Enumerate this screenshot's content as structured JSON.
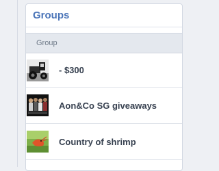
{
  "panel": {
    "title": "Groups",
    "column_header": "Group"
  },
  "groups": [
    {
      "name": "- $300",
      "avatar_icon": "tractor-photo-avatar"
    },
    {
      "name": "Aon&Co SG giveaways",
      "avatar_icon": "group-photo-avatar"
    },
    {
      "name": "Country of shrimp",
      "avatar_icon": "shrimp-photo-avatar"
    }
  ],
  "colors": {
    "title": "#4a74b8",
    "column_header_bg": "#e4e8ee",
    "row_text": "#374150",
    "page_bg": "#eef0f4"
  }
}
